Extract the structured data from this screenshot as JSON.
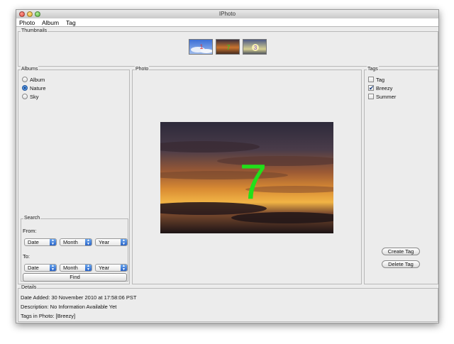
{
  "window": {
    "title": "IPhoto"
  },
  "menu": [
    "Photo",
    "Album",
    "Tag"
  ],
  "thumbnails": {
    "legend": "Thumbnails",
    "items": [
      "thumbnail-1",
      "thumbnail-2",
      "thumbnail-3"
    ]
  },
  "albums": {
    "legend": "Albums",
    "items": [
      {
        "label": "Album",
        "selected": false
      },
      {
        "label": "Nature",
        "selected": true
      },
      {
        "label": "Sky",
        "selected": false
      }
    ]
  },
  "search": {
    "legend": "Search",
    "from_label": "From:",
    "to_label": "To:",
    "from": {
      "date": "Date",
      "month": "Month",
      "year": "Year"
    },
    "to": {
      "date": "Date",
      "month": "Month",
      "year": "Year"
    },
    "find_label": "Find"
  },
  "photo": {
    "legend": "Photo",
    "overlay_number": "7",
    "overlay_color": "#22e01a"
  },
  "tags": {
    "legend": "Tags",
    "items": [
      {
        "label": "Tag",
        "checked": false
      },
      {
        "label": "Breezy",
        "checked": true
      },
      {
        "label": "Summer",
        "checked": false
      }
    ],
    "create_label": "Create Tag",
    "delete_label": "Delete Tag"
  },
  "details": {
    "legend": "Details",
    "date_added": "Date Added: 30 November 2010 at 17:58:06 PST",
    "description": "Description: No Information Available Yet",
    "tags_in_photo": "Tags in Photo: [Breezy]"
  }
}
